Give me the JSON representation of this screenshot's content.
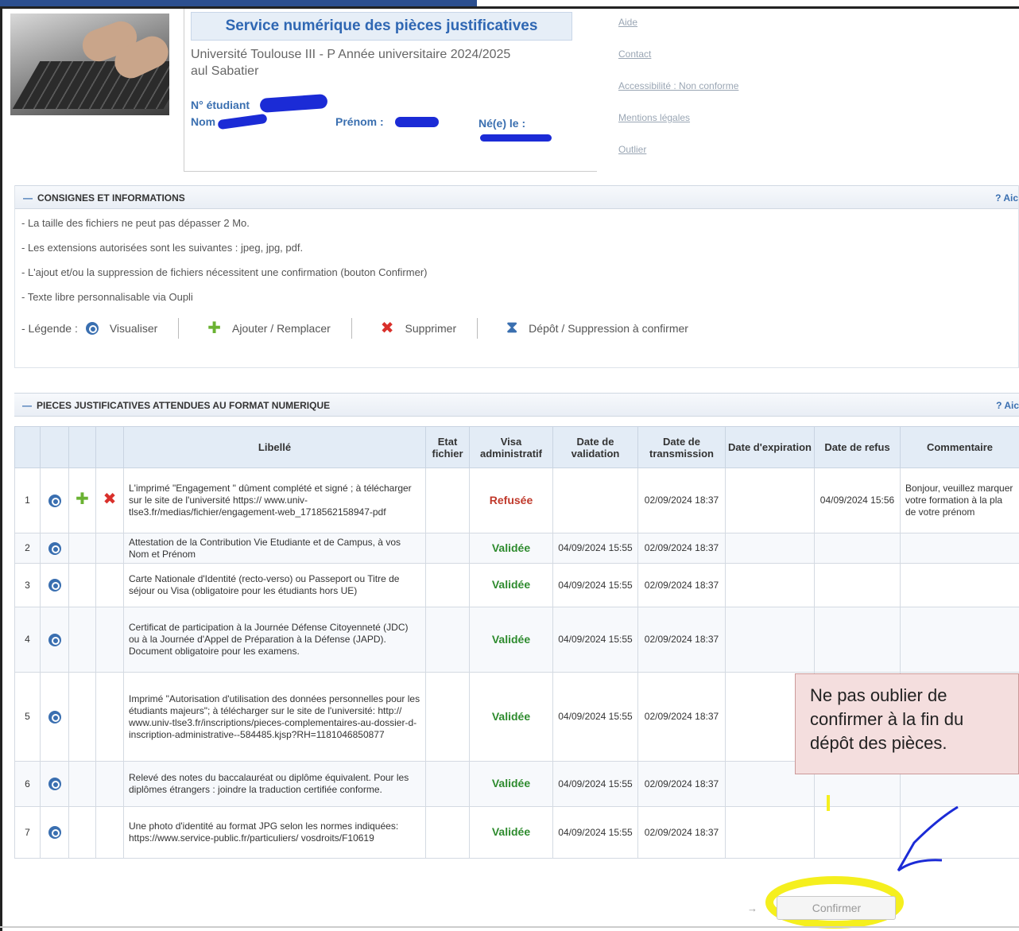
{
  "header": {
    "service_title": "Service numérique des pièces justificatives",
    "university_line1": "Université Toulouse III - P Année universitaire 2024/2025",
    "university_line2": "aul Sabatier",
    "student_no_label": "N° étudiant",
    "nom_label": "Nom",
    "prenom_label": "Prénom :",
    "naissance_label": "Né(e) le :",
    "links": [
      "Aide",
      "Contact",
      "Accessibilité : Non conforme",
      "Mentions légales",
      "Outlier"
    ]
  },
  "consignes": {
    "title": "CONSIGNES ET INFORMATIONS",
    "aide": "? Aic",
    "lines": [
      "- La taille des fichiers ne peut pas dépasser 2 Mo.",
      "- Les extensions autorisées sont les suivantes : jpeg, jpg, pdf.",
      "- L'ajout et/ou la suppression de fichiers nécessitent une confirmation (bouton Confirmer)",
      "- Texte libre personnalisable via Oupli"
    ],
    "legend_label": "- Légende :",
    "legend_items": [
      "Visualiser",
      "Ajouter / Remplacer",
      "Supprimer",
      "Dépôt / Suppression à confirmer"
    ]
  },
  "pieces": {
    "title": "PIECES JUSTIFICATIVES ATTENDUES AU FORMAT NUMERIQUE",
    "aide": "? Aic",
    "columns": [
      "Libellé",
      "Etat fichier",
      "Visa administratif",
      "Date de validation",
      "Date de transmission",
      "Date d'expiration",
      "Date de refus",
      "Commentaire"
    ],
    "rows": [
      {
        "num": "1",
        "libelle": "L'imprimé \"Engagement \" dûment complété et signé ; à télécharger sur le site de l'université https:// www.univ-tlse3.fr/medias/fichier/engagement-web_1718562158947-pdf",
        "visa": "Refusée",
        "validation": "",
        "transmission": "02/09/2024 18:37",
        "refus": "04/09/2024 15:56",
        "commentaire": "Bonjour, veuillez marquer votre formation à la pla de votre prénom"
      },
      {
        "num": "2",
        "libelle": "Attestation de la Contribution Vie Etudiante et de Campus, à vos Nom et Prénom",
        "visa": "Validée",
        "validation": "04/09/2024 15:55",
        "transmission": "02/09/2024 18:37",
        "refus": "",
        "commentaire": ""
      },
      {
        "num": "3",
        "libelle": "Carte Nationale d'Identité (recto-verso) ou Passeport ou Titre de séjour ou Visa (obligatoire pour les étudiants hors UE)",
        "visa": "Validée",
        "validation": "04/09/2024 15:55",
        "transmission": "02/09/2024 18:37",
        "refus": "",
        "commentaire": ""
      },
      {
        "num": "4",
        "libelle": "Certificat de participation à la Journée Défense Citoyenneté (JDC) ou à la Journée d'Appel de Préparation à la Défense (JAPD). Document obligatoire pour les examens.",
        "visa": "Validée",
        "validation": "04/09/2024 15:55",
        "transmission": "02/09/2024 18:37",
        "refus": "",
        "commentaire": ""
      },
      {
        "num": "5",
        "libelle": "Imprimé \"Autorisation d'utilisation des données personnelles pour les étudiants majeurs\"; à télécharger sur le site de l'université: http:// www.univ-tlse3.fr/inscriptions/pieces-complementaires-au-dossier-d-inscription-administrative--584485.kjsp?RH=1181046850877",
        "visa": "Validée",
        "validation": "04/09/2024 15:55",
        "transmission": "02/09/2024 18:37",
        "refus": "",
        "commentaire": ""
      },
      {
        "num": "6",
        "libelle": "Relevé des notes du baccalauréat ou diplôme équivalent. Pour les diplômes étrangers : joindre la traduction certifiée conforme.",
        "visa": "Validée",
        "validation": "04/09/2024 15:55",
        "transmission": "02/09/2024 18:37",
        "refus": "",
        "commentaire": ""
      },
      {
        "num": "7",
        "libelle": "Une photo d'identité au format JPG selon les normes indiquées: https://www.service-public.fr/particuliers/ vosdroits/F10619",
        "visa": "Validée",
        "validation": "04/09/2024 15:55",
        "transmission": "02/09/2024 18:37",
        "refus": "",
        "commentaire": ""
      }
    ]
  },
  "callout_text": "Ne pas oublier de confirmer à la fin du dépôt des pièces.",
  "confirm_label": "Confirmer",
  "confirm_arrow": "→",
  "colors": {
    "accent": "#3a6fb0",
    "refused": "#c0392b",
    "validated": "#2e8b2e",
    "highlight": "#f5ef1e",
    "annotation": "#1b2bd6"
  }
}
